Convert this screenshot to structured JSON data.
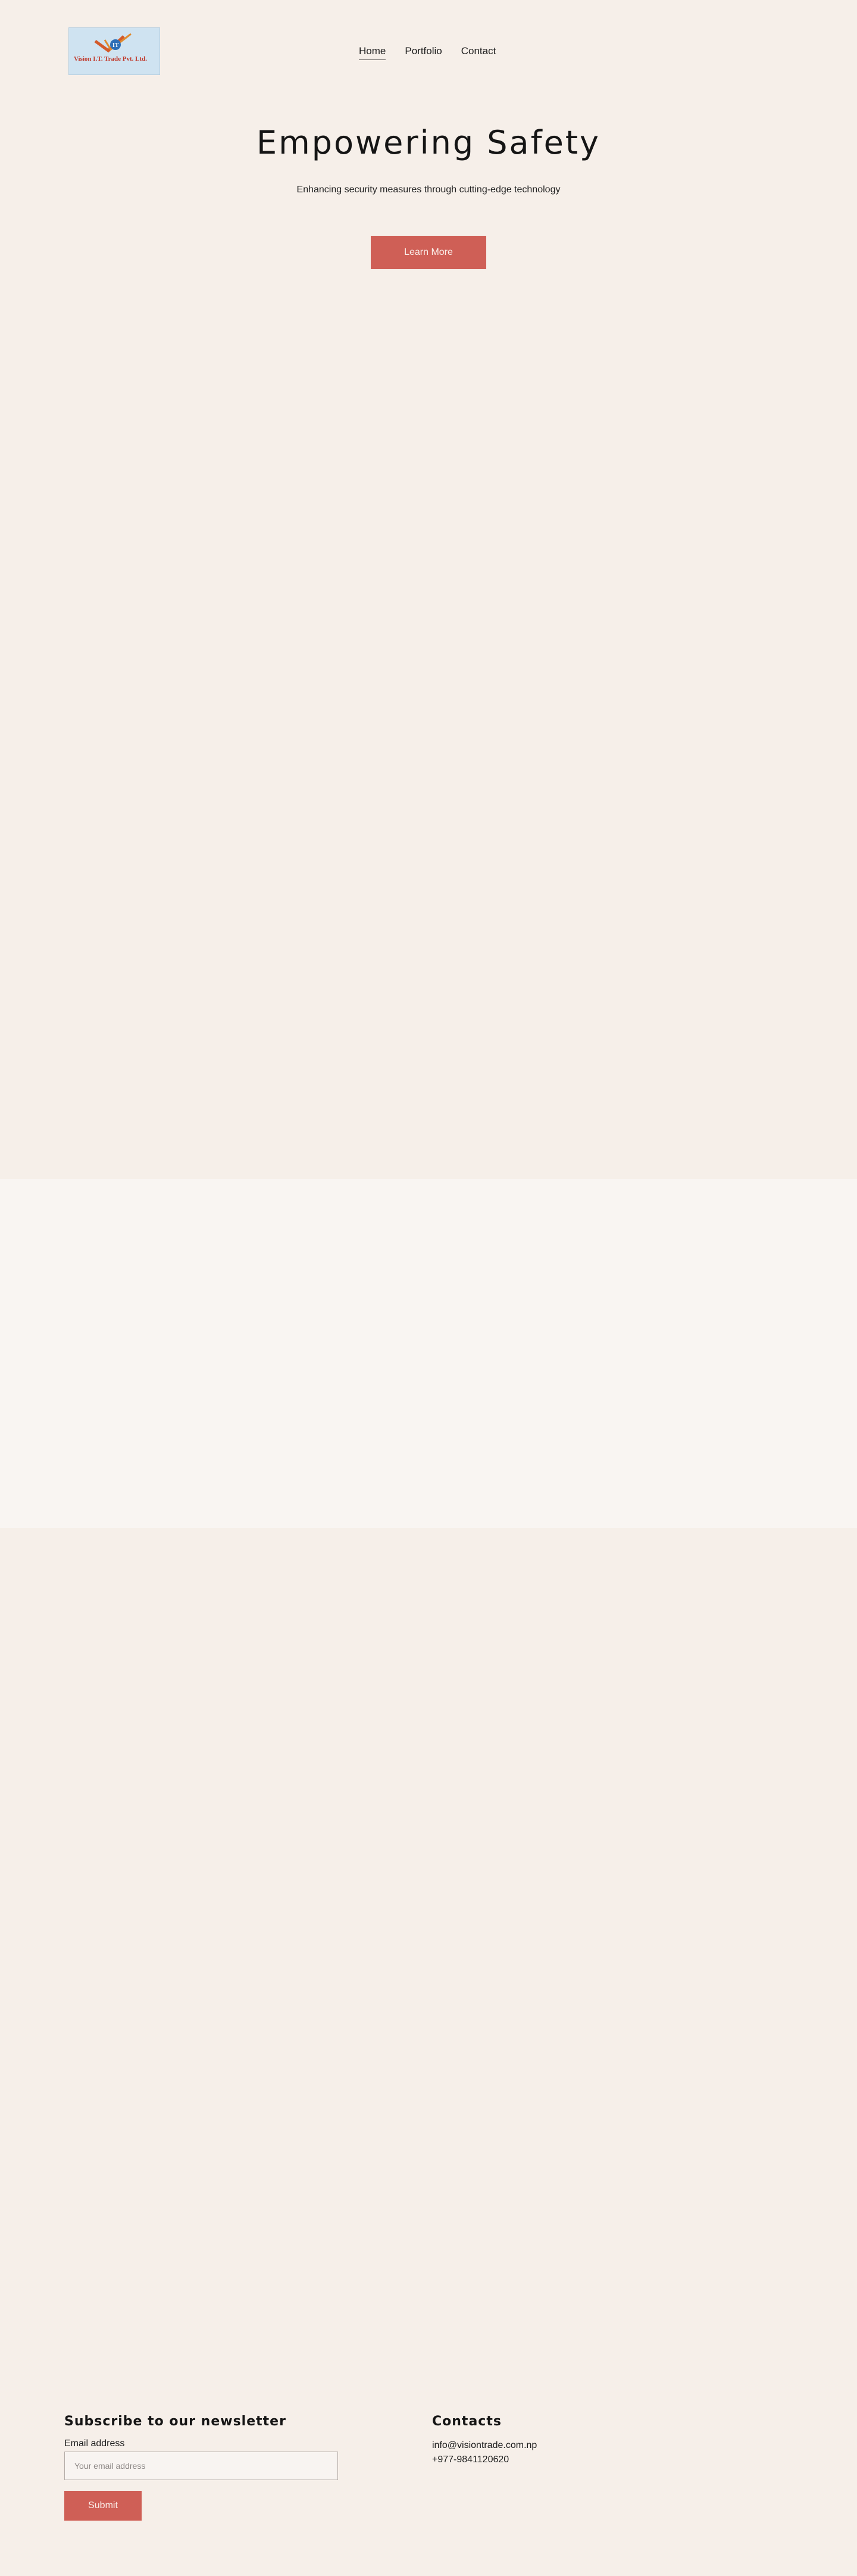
{
  "header": {
    "logo": {
      "company": "Vision I.T. Trade Pvt. Ltd."
    },
    "nav": [
      {
        "label": "Home",
        "active": true
      },
      {
        "label": "Portfolio",
        "active": false
      },
      {
        "label": "Contact",
        "active": false
      }
    ]
  },
  "hero": {
    "title": "Empowering Safety",
    "subtitle": "Enhancing security measures through cutting-edge technology",
    "cta_label": "Learn More"
  },
  "newsletter": {
    "heading": "Subscribe to our newsletter",
    "email_label": "Email address",
    "email_placeholder": "Your email address",
    "email_value": "",
    "submit_label": "Submit"
  },
  "contacts": {
    "heading": "Contacts",
    "email": "info@visiontrade.com.np",
    "phone": "+977-9841120620"
  },
  "colors": {
    "background": "#f6efe9",
    "band": "#f9f5f2",
    "accent": "#cf5f56"
  }
}
